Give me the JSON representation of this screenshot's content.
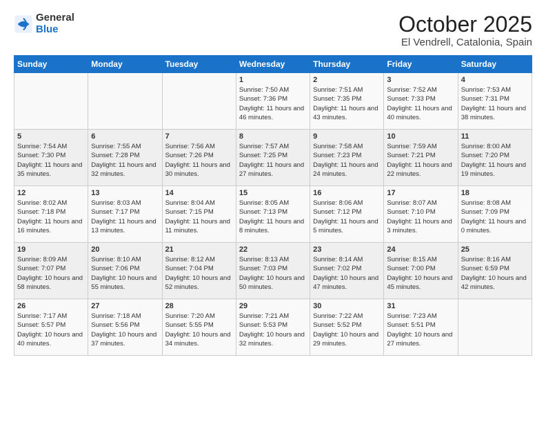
{
  "logo": {
    "general": "General",
    "blue": "Blue"
  },
  "title": "October 2025",
  "subtitle": "El Vendrell, Catalonia, Spain",
  "headers": [
    "Sunday",
    "Monday",
    "Tuesday",
    "Wednesday",
    "Thursday",
    "Friday",
    "Saturday"
  ],
  "weeks": [
    [
      {
        "day": "",
        "info": ""
      },
      {
        "day": "",
        "info": ""
      },
      {
        "day": "",
        "info": ""
      },
      {
        "day": "1",
        "info": "Sunrise: 7:50 AM\nSunset: 7:36 PM\nDaylight: 11 hours\nand 46 minutes."
      },
      {
        "day": "2",
        "info": "Sunrise: 7:51 AM\nSunset: 7:35 PM\nDaylight: 11 hours\nand 43 minutes."
      },
      {
        "day": "3",
        "info": "Sunrise: 7:52 AM\nSunset: 7:33 PM\nDaylight: 11 hours\nand 40 minutes."
      },
      {
        "day": "4",
        "info": "Sunrise: 7:53 AM\nSunset: 7:31 PM\nDaylight: 11 hours\nand 38 minutes."
      }
    ],
    [
      {
        "day": "5",
        "info": "Sunrise: 7:54 AM\nSunset: 7:30 PM\nDaylight: 11 hours\nand 35 minutes."
      },
      {
        "day": "6",
        "info": "Sunrise: 7:55 AM\nSunset: 7:28 PM\nDaylight: 11 hours\nand 32 minutes."
      },
      {
        "day": "7",
        "info": "Sunrise: 7:56 AM\nSunset: 7:26 PM\nDaylight: 11 hours\nand 30 minutes."
      },
      {
        "day": "8",
        "info": "Sunrise: 7:57 AM\nSunset: 7:25 PM\nDaylight: 11 hours\nand 27 minutes."
      },
      {
        "day": "9",
        "info": "Sunrise: 7:58 AM\nSunset: 7:23 PM\nDaylight: 11 hours\nand 24 minutes."
      },
      {
        "day": "10",
        "info": "Sunrise: 7:59 AM\nSunset: 7:21 PM\nDaylight: 11 hours\nand 22 minutes."
      },
      {
        "day": "11",
        "info": "Sunrise: 8:00 AM\nSunset: 7:20 PM\nDaylight: 11 hours\nand 19 minutes."
      }
    ],
    [
      {
        "day": "12",
        "info": "Sunrise: 8:02 AM\nSunset: 7:18 PM\nDaylight: 11 hours\nand 16 minutes."
      },
      {
        "day": "13",
        "info": "Sunrise: 8:03 AM\nSunset: 7:17 PM\nDaylight: 11 hours\nand 13 minutes."
      },
      {
        "day": "14",
        "info": "Sunrise: 8:04 AM\nSunset: 7:15 PM\nDaylight: 11 hours\nand 11 minutes."
      },
      {
        "day": "15",
        "info": "Sunrise: 8:05 AM\nSunset: 7:13 PM\nDaylight: 11 hours\nand 8 minutes."
      },
      {
        "day": "16",
        "info": "Sunrise: 8:06 AM\nSunset: 7:12 PM\nDaylight: 11 hours\nand 5 minutes."
      },
      {
        "day": "17",
        "info": "Sunrise: 8:07 AM\nSunset: 7:10 PM\nDaylight: 11 hours\nand 3 minutes."
      },
      {
        "day": "18",
        "info": "Sunrise: 8:08 AM\nSunset: 7:09 PM\nDaylight: 11 hours\nand 0 minutes."
      }
    ],
    [
      {
        "day": "19",
        "info": "Sunrise: 8:09 AM\nSunset: 7:07 PM\nDaylight: 10 hours\nand 58 minutes."
      },
      {
        "day": "20",
        "info": "Sunrise: 8:10 AM\nSunset: 7:06 PM\nDaylight: 10 hours\nand 55 minutes."
      },
      {
        "day": "21",
        "info": "Sunrise: 8:12 AM\nSunset: 7:04 PM\nDaylight: 10 hours\nand 52 minutes."
      },
      {
        "day": "22",
        "info": "Sunrise: 8:13 AM\nSunset: 7:03 PM\nDaylight: 10 hours\nand 50 minutes."
      },
      {
        "day": "23",
        "info": "Sunrise: 8:14 AM\nSunset: 7:02 PM\nDaylight: 10 hours\nand 47 minutes."
      },
      {
        "day": "24",
        "info": "Sunrise: 8:15 AM\nSunset: 7:00 PM\nDaylight: 10 hours\nand 45 minutes."
      },
      {
        "day": "25",
        "info": "Sunrise: 8:16 AM\nSunset: 6:59 PM\nDaylight: 10 hours\nand 42 minutes."
      }
    ],
    [
      {
        "day": "26",
        "info": "Sunrise: 7:17 AM\nSunset: 5:57 PM\nDaylight: 10 hours\nand 40 minutes."
      },
      {
        "day": "27",
        "info": "Sunrise: 7:18 AM\nSunset: 5:56 PM\nDaylight: 10 hours\nand 37 minutes."
      },
      {
        "day": "28",
        "info": "Sunrise: 7:20 AM\nSunset: 5:55 PM\nDaylight: 10 hours\nand 34 minutes."
      },
      {
        "day": "29",
        "info": "Sunrise: 7:21 AM\nSunset: 5:53 PM\nDaylight: 10 hours\nand 32 minutes."
      },
      {
        "day": "30",
        "info": "Sunrise: 7:22 AM\nSunset: 5:52 PM\nDaylight: 10 hours\nand 29 minutes."
      },
      {
        "day": "31",
        "info": "Sunrise: 7:23 AM\nSunset: 5:51 PM\nDaylight: 10 hours\nand 27 minutes."
      },
      {
        "day": "",
        "info": ""
      }
    ]
  ]
}
